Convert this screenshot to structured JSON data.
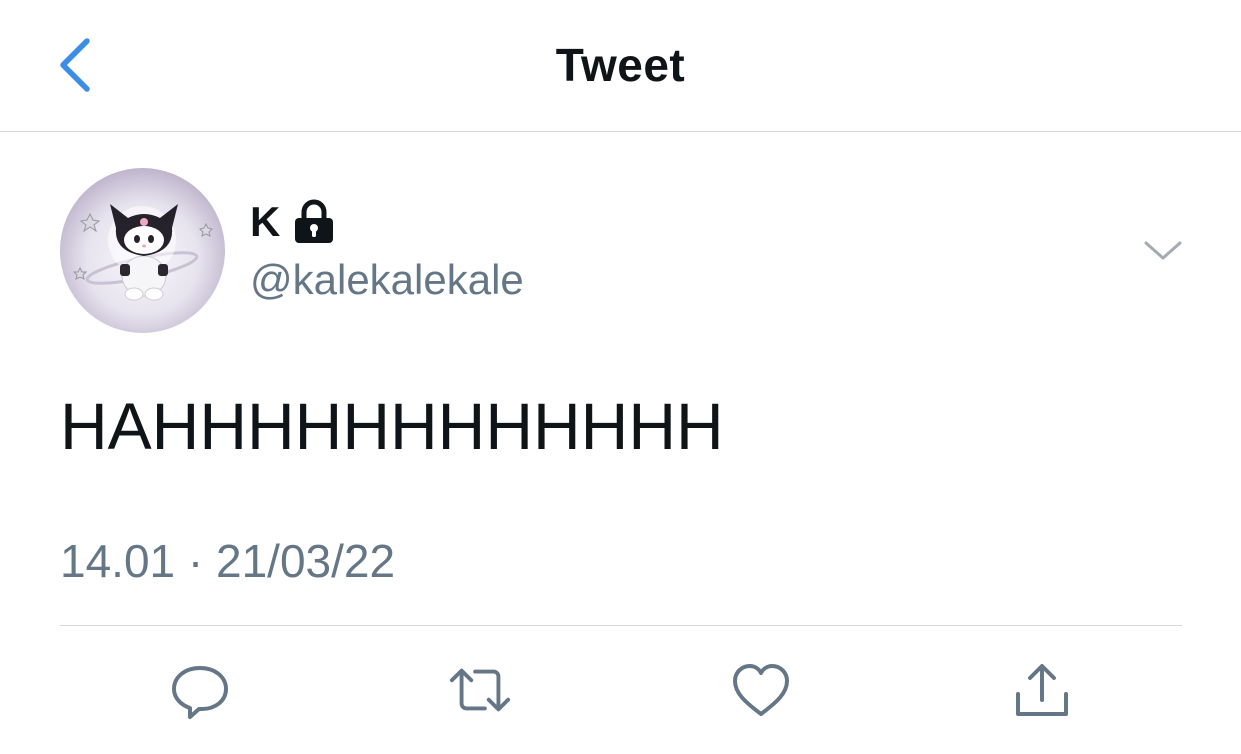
{
  "header": {
    "title": "Tweet",
    "back_icon": "chevron-left-icon"
  },
  "author": {
    "name": "K",
    "handle": "@kalekalekale",
    "protected_icon": "lock-icon",
    "avatar": "kuromi-astronaut-avatar"
  },
  "tweet": {
    "text": "HAHHHHHHHHHHHH",
    "timestamp": "14.01 · 21/03/22"
  },
  "actions": [
    {
      "icon": "reply-icon"
    },
    {
      "icon": "retweet-icon"
    },
    {
      "icon": "like-icon"
    },
    {
      "icon": "share-icon"
    }
  ],
  "colors": {
    "accent": "#1da1f2",
    "secondary_text": "#657786",
    "primary_text": "#0f1419",
    "divider": "#d5d9dd"
  }
}
